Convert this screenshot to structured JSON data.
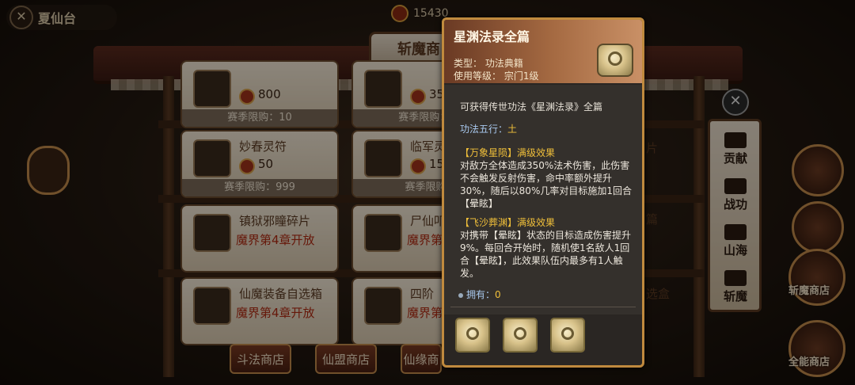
{
  "topbar": {
    "back_label": "夏仙台",
    "currency_value": "15430"
  },
  "shop": {
    "title": "斩魔商",
    "items": [
      {
        "name": "",
        "price": "800",
        "limit": "赛季限购：10"
      },
      {
        "name": "",
        "price": "35",
        "limit": "赛季限购：10"
      },
      {
        "name": "妙春灵符",
        "price": "50",
        "limit": "赛季限购：999"
      },
      {
        "name": "临军灵",
        "price": "15",
        "limit": "赛季限购："
      },
      {
        "name": "镇狱邪瞳碎片",
        "unlock": "魔界第4章开放"
      },
      {
        "name": "尸仙叩",
        "unlock": "魔界第"
      },
      {
        "name": "仙魔装备自选箱",
        "unlock": "魔界第4章开放"
      },
      {
        "name": "四阶",
        "unlock": "魔界第"
      }
    ],
    "bottom_tabs": [
      "斗法商店",
      "仙盟商店",
      "仙缘商"
    ],
    "side_tabs": [
      "贡献",
      "战功",
      "山海",
      "斩魔"
    ],
    "right_avatar_label": "斩魔商店",
    "right_avatar_label_2": "全能商店",
    "peek_right_1": "片",
    "peek_right_2": "篇",
    "peek_right_3": "选盒"
  },
  "tooltip": {
    "title": "星渊法录全篇",
    "type_line": "类型：  功法典籍",
    "level_line": "使用等级：  宗门1级",
    "obtain_line": "可获得传世功法《星渊法录》全篇",
    "element_label": "功法五行：",
    "element_value": "土",
    "effect1_title": "【万象星陨】满级效果",
    "effect1_desc": "对敌方全体造成350%法术伤害，此伤害不会触发反射伤害，命中率额外提升30%，随后以80%几率对目标施加1回合【晕眩】",
    "effect2_title": "【飞沙葬渊】满级效果",
    "effect2_desc": "对携带【晕眩】状态的目标造成伤害提升9%。每回合开始时，随机使1名敌人1回合【晕眩】，此效果队伍内最多有1人触发。",
    "own_label": "拥有：",
    "own_value": "0",
    "source_slots": 3
  },
  "colors": {
    "tooltip_border": "#c08a3e",
    "highlight_gold": "#f0bf3a",
    "highlight_blue": "#a9c9ef"
  }
}
